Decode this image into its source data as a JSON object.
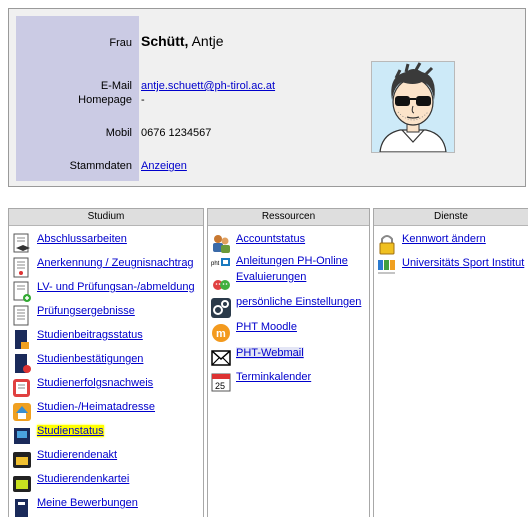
{
  "profile": {
    "salutation": "Frau",
    "surname": "Schütt,",
    "firstname": "Antje",
    "email_label": "E-Mail",
    "email": "antje.schuett@ph-tirol.ac.at",
    "homepage_label": "Homepage",
    "homepage": "-",
    "mobil_label": "Mobil",
    "mobil": "0676 1234567",
    "stammdaten_label": "Stammdaten",
    "stammdaten_link": "Anzeigen"
  },
  "columns": {
    "studium": {
      "title": "Studium",
      "items": [
        {
          "label": "Abschlussarbeiten",
          "icon": "graduation-document-icon"
        },
        {
          "label": "Anerkennung / Zeugnisnachtrag",
          "icon": "certificate-document-icon"
        },
        {
          "label": "LV- und Prüfungsan-/abmeldung",
          "icon": "document-plus-icon"
        },
        {
          "label": "Prüfungsergebnisse",
          "icon": "results-document-icon"
        },
        {
          "label": "Studienbeitragsstatus",
          "icon": "fee-status-icon"
        },
        {
          "label": "Studienbestätigungen",
          "icon": "confirmation-document-icon"
        },
        {
          "label": "Studienerfolgsnachweis",
          "icon": "success-certificate-icon"
        },
        {
          "label": "Studien-/Heimatadresse",
          "icon": "home-icon"
        },
        {
          "label": "Studienstatus",
          "icon": "status-monitor-icon"
        },
        {
          "label": "Studierendenakt",
          "icon": "folder-icon"
        },
        {
          "label": "Studierendenkartei",
          "icon": "card-file-icon"
        },
        {
          "label": "Meine Bewerbungen",
          "icon": "application-document-icon"
        }
      ]
    },
    "ressourcen": {
      "title": "Ressourcen",
      "items": [
        {
          "label": "Accountstatus",
          "icon": "users-account-icon"
        },
        {
          "label": "Anleitungen PH-Online",
          "icon": "pht-guide-icon"
        },
        {
          "label": "Evaluierungen",
          "icon": "evaluation-faces-icon"
        },
        {
          "label": "persönliche Einstellungen",
          "icon": "settings-gears-icon"
        },
        {
          "label": "PHT Moodle",
          "icon": "moodle-icon"
        },
        {
          "label": "PHT-Webmail",
          "icon": "envelope-icon"
        },
        {
          "label": "Terminkalender",
          "icon": "calendar-icon"
        }
      ],
      "calendar_day": "25"
    },
    "dienste": {
      "title": "Dienste",
      "items": [
        {
          "label": "Kennwort ändern",
          "icon": "padlock-icon"
        },
        {
          "label": "Universitäts Sport Institut",
          "icon": "usi-logo-icon"
        }
      ]
    }
  },
  "colors": {
    "link": "#0000cc",
    "label_column": "#cbcbe4",
    "highlight": "#ffff00"
  }
}
